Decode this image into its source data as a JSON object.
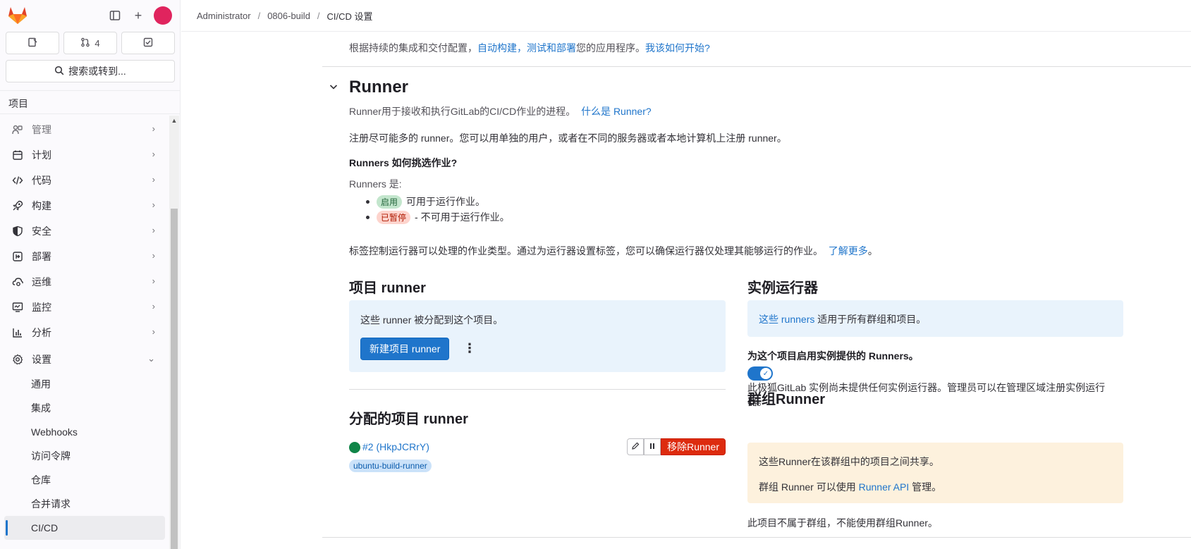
{
  "sidebar": {
    "merge_requests_count": "4",
    "search_label": "搜索或转到...",
    "section_title": "项目",
    "nav": [
      {
        "label": "管理"
      },
      {
        "label": "计划"
      },
      {
        "label": "代码"
      },
      {
        "label": "构建"
      },
      {
        "label": "安全"
      },
      {
        "label": "部署"
      },
      {
        "label": "运维"
      },
      {
        "label": "监控"
      },
      {
        "label": "分析"
      },
      {
        "label": "设置"
      }
    ],
    "settings_sub": [
      {
        "label": "通用"
      },
      {
        "label": "集成"
      },
      {
        "label": "Webhooks"
      },
      {
        "label": "访问令牌"
      },
      {
        "label": "仓库"
      },
      {
        "label": "合并请求"
      },
      {
        "label": "CI/CD"
      }
    ]
  },
  "breadcrumb": {
    "items": [
      "Administrator",
      "0806-build",
      "CI/CD 设置"
    ]
  },
  "main": {
    "lead_text": "根据持续的集成和交付配置，",
    "lead_link1": "自动构建，测试和部署",
    "lead_text2": "您的应用程序。",
    "lead_link2": "我该如何开始?",
    "runner_title": "Runner",
    "runner_desc": "Runner用于接收和执行GitLab的CI/CD作业的进程。",
    "runner_desc_link": "什么是 Runner?",
    "register_text": "注册尽可能多的 runner。您可以用单独的用户，或者在不同的服务器或者本地计算机上注册 runner。",
    "how_pick": "Runners 如何挑选作业?",
    "runners_are": "Runners 是:",
    "badge_enabled": "启用",
    "enabled_text": "可用于运行作业。",
    "badge_paused": "已暂停",
    "paused_text": "- 不可用于运行作业。",
    "tags_text": "标签控制运行器可以处理的作业类型。通过为运行器设置标签，您可以确保运行器仅处理其能够运行的作业。",
    "learn_more": "了解更多",
    "learn_more_suffix": "。"
  },
  "project_runners": {
    "title": "项目 runner",
    "info": "这些 runner 被分配到这个项目。",
    "new_button": "新建项目 runner",
    "assigned_title": "分配的项目 runner",
    "runner_name": "#2 (HkpJCRrY)",
    "remove_button": "移除Runner",
    "tag": "ubuntu-build-runner",
    "status_color": "#108548"
  },
  "instance_runners": {
    "title": "实例运行器",
    "info_link": "这些 runners",
    "info_text": " 适用于所有群组和项目。",
    "enable_label": "为这个项目启用实例提供的 Runners。",
    "toggle_on": true,
    "no_runner_text": "此极狐GitLab 实例尚未提供任何实例运行器。管理员可以在管理区域注册实例运行器。"
  },
  "group_runners": {
    "title": "群组Runner",
    "shared_text": "这些Runner在该群组中的项目之间共享。",
    "api_text1": "群组 Runner 可以使用 ",
    "api_link": "Runner API",
    "api_text2": " 管理。",
    "not_group_text": "此项目不属于群组，不能使用群组Runner。"
  },
  "colors": {
    "accent": "#1f75cb",
    "danger": "#dd2b0e"
  }
}
